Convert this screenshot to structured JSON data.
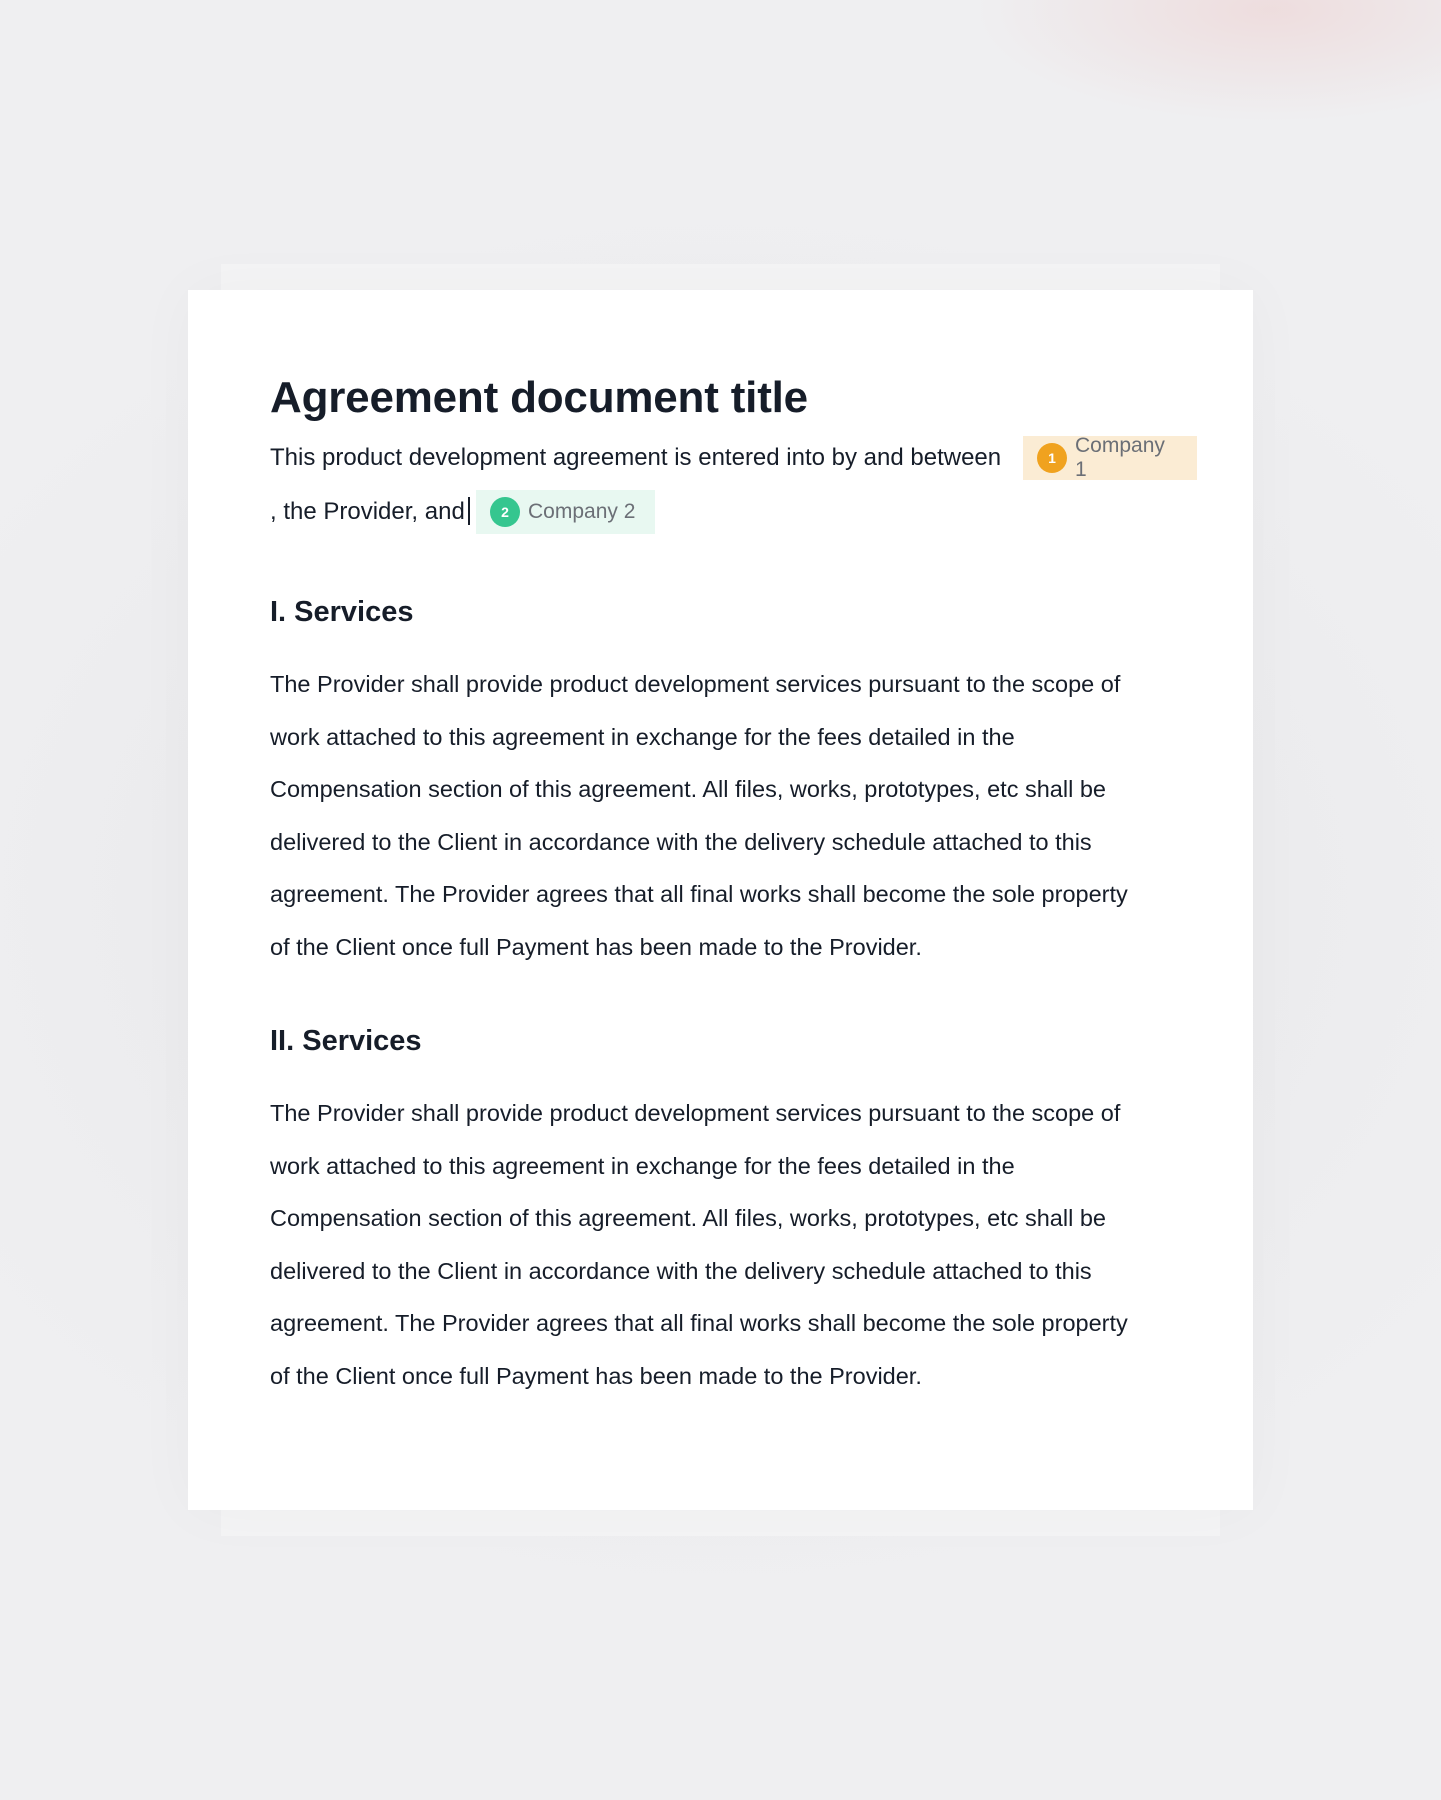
{
  "document": {
    "title": "Agreement document title",
    "intro": {
      "text_before": "This product development agreement is entered into by and between",
      "party_1": {
        "number": "1",
        "label": "Company 1",
        "color": "#f0a21f",
        "bg": "#fbecd4"
      },
      "text_middle": ", the Provider, and",
      "party_2": {
        "number": "2",
        "label": "Company 2",
        "color": "#35c68f",
        "bg": "#e8f8f1"
      }
    },
    "sections": [
      {
        "heading": "I. Services",
        "lines": [
          "The Provider shall provide product development services pursuant to the scope of",
          "work attached to this agreement in exchange for the fees detailed in the",
          "Compensation section of this agreement. All files, works, prototypes, etc shall be",
          "delivered to the Client in accordance with the delivery schedule attached to this",
          "agreement. The Provider agrees that all final works shall become the sole property",
          "of the Client once full Payment has been made to the Provider."
        ]
      },
      {
        "heading": "II. Services",
        "lines": [
          "The Provider shall provide product development services pursuant to the scope of",
          "work attached to this agreement in exchange for the fees detailed in the",
          "Compensation section of this agreement. All files, works, prototypes, etc shall be",
          "delivered to the Client in accordance with the delivery schedule attached to this",
          "agreement. The Provider agrees that all final works shall become the sole property",
          "of the Client once full Payment has been made to the Provider."
        ]
      }
    ]
  }
}
